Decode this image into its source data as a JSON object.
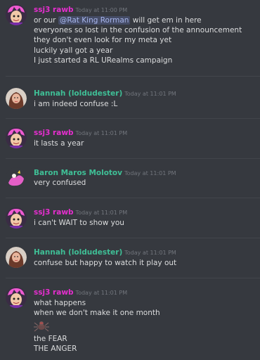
{
  "colors": {
    "background": "#36393f",
    "ssj3": "#e62ecf",
    "hannah": "#3fbf96",
    "baron": "#3fbf96",
    "mention_bg": "#404775",
    "timestamp": "#72767d"
  },
  "messages": [
    {
      "user": "ssj3 rawb",
      "time": "Today at 11:00 PM",
      "line1_prefix": "or our ",
      "mention": "@Rat King Rorman",
      "line1_suffix": " will get em in here",
      "lines": [
        "everyones so lost in the confusion of the announcement",
        "they don't even look for my meta yet",
        "luckily yall got a year",
        "I just started a RL URealms campaign"
      ]
    },
    {
      "user": "Hannah (loldudester)",
      "time": "Today at 11:01 PM",
      "lines": [
        "i am indeed confuse :L"
      ]
    },
    {
      "user": "ssj3 rawb",
      "time": "Today at 11:01 PM",
      "lines": [
        "it lasts a year"
      ]
    },
    {
      "user": "Baron Maros Molotov",
      "time": "Today at 11:01 PM",
      "lines": [
        "very confused"
      ]
    },
    {
      "user": "ssj3 rawb",
      "time": "Today at 11:01 PM",
      "lines": [
        "i can't WAIT to show you"
      ]
    },
    {
      "user": "Hannah (loldudester)",
      "time": "Today at 11:01 PM",
      "lines": [
        "confuse but happy to watch it play out"
      ]
    },
    {
      "user": "ssj3 rawb",
      "time": "Today at 11:01 PM",
      "lines": [
        "what happens",
        "when we don't make it one month"
      ],
      "emoji": "spider-emoji",
      "lines_after": [
        "the FEAR",
        "THE ANGER"
      ]
    }
  ]
}
